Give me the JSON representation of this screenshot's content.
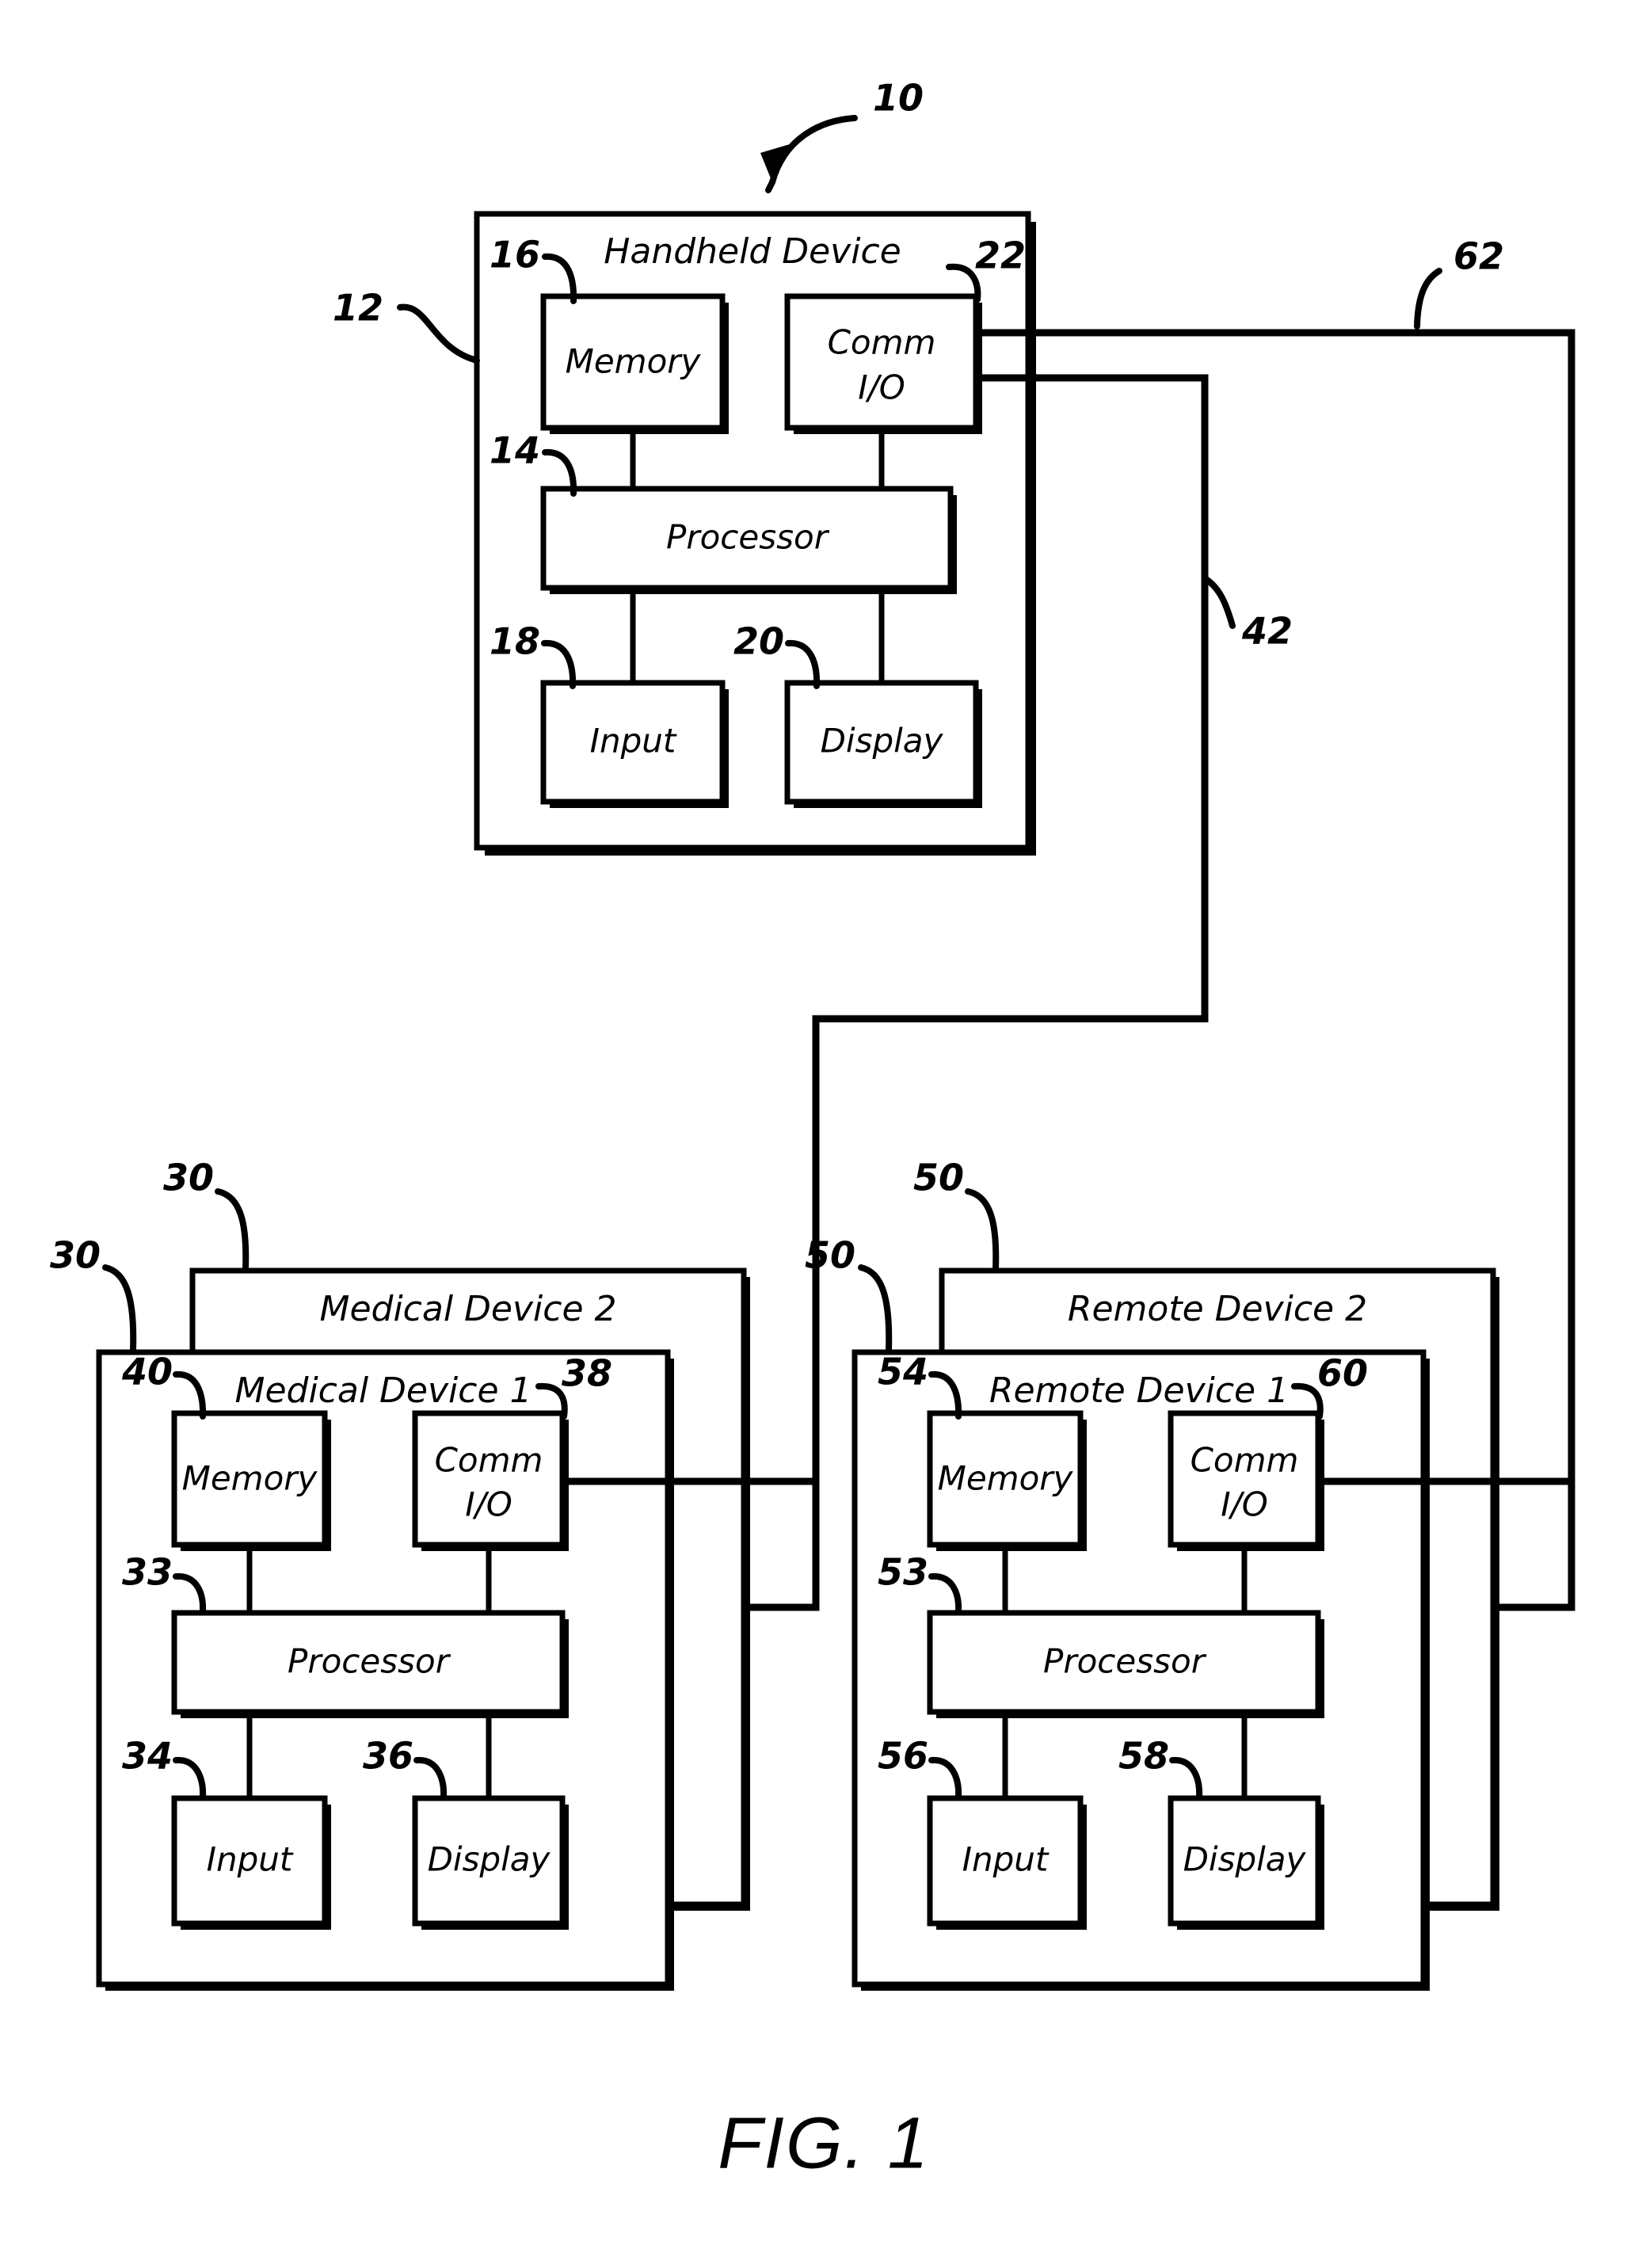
{
  "figure": {
    "caption": "FIG. 1",
    "system_ref": "10"
  },
  "devices": [
    {
      "id": "handheld",
      "title": "Handheld Device",
      "ref": "12",
      "blocks": [
        {
          "id": "memory",
          "label": "Memory",
          "ref": "16"
        },
        {
          "id": "comm_io",
          "label_line1": "Comm",
          "label_line2": "I/O",
          "ref": "22"
        },
        {
          "id": "processor",
          "label": "Processor",
          "ref": "14"
        },
        {
          "id": "input",
          "label": "Input",
          "ref": "18"
        },
        {
          "id": "display",
          "label": "Display",
          "ref": "20"
        }
      ]
    },
    {
      "id": "medical2",
      "title": "Medical Device 2",
      "ref": "30"
    },
    {
      "id": "medical1",
      "title": "Medical Device 1",
      "ref": "30",
      "blocks": [
        {
          "id": "memory",
          "label": "Memory",
          "ref": "40"
        },
        {
          "id": "comm_io",
          "label_line1": "Comm",
          "label_line2": "I/O",
          "ref": "38"
        },
        {
          "id": "processor",
          "label": "Processor",
          "ref": "33"
        },
        {
          "id": "input",
          "label": "Input",
          "ref": "34"
        },
        {
          "id": "display",
          "label": "Display",
          "ref": "36"
        }
      ]
    },
    {
      "id": "remote2",
      "title": "Remote Device 2",
      "ref": "50"
    },
    {
      "id": "remote1",
      "title": "Remote Device 1",
      "ref": "50",
      "blocks": [
        {
          "id": "memory",
          "label": "Memory",
          "ref": "54"
        },
        {
          "id": "comm_io",
          "label_line1": "Comm",
          "label_line2": "I/O",
          "ref": "60"
        },
        {
          "id": "processor",
          "label": "Processor",
          "ref": "53"
        },
        {
          "id": "input",
          "label": "Input",
          "ref": "56"
        },
        {
          "id": "display",
          "label": "Display",
          "ref": "58"
        }
      ]
    }
  ],
  "connections": [
    {
      "id": "link_handheld_remote",
      "ref": "62"
    },
    {
      "id": "link_handheld_medical",
      "ref": "42"
    }
  ],
  "colors": {
    "ink": "#000000",
    "paper": "#ffffff"
  }
}
